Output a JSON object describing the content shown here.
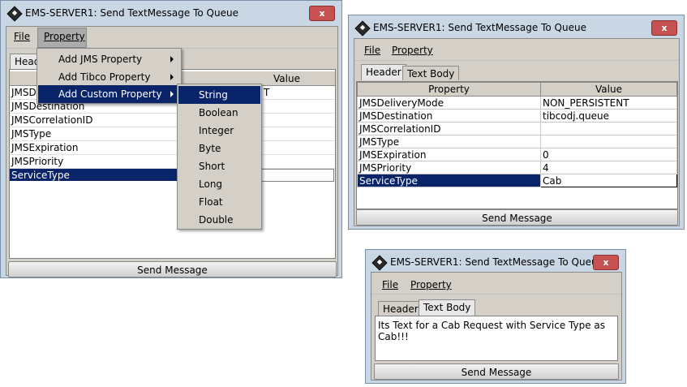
{
  "window_title": "EMS-SERVER1: Send TextMessage To Queue",
  "close_label": "x",
  "menu": {
    "file": "File",
    "property": "Property"
  },
  "tabs": {
    "header": "Header",
    "text_body": "Text Body"
  },
  "header_clipped": "Head",
  "columns": {
    "property": "Property",
    "value": "Value"
  },
  "rows": [
    {
      "property": "JMSDeliveryMode",
      "value": "NON_PERSISTENT"
    },
    {
      "property": "JMSDestination",
      "value": "tibcodj.queue"
    },
    {
      "property": "JMSCorrelationID",
      "value": ""
    },
    {
      "property": "JMSType",
      "value": ""
    },
    {
      "property": "JMSExpiration",
      "value": "0"
    },
    {
      "property": "JMSPriority",
      "value": "4"
    },
    {
      "property": "ServiceType",
      "value": "Cab"
    }
  ],
  "left_rows_visible": {
    "r0": "JMSDel",
    "r1": "JMSDestination",
    "r2": "JMSCorrelationID",
    "r3": "JMSType",
    "r4": "JMSExpiration",
    "r5": "JMSPriority",
    "r6": "ServiceType",
    "v0": "T"
  },
  "property_menu": [
    "Add JMS Property",
    "Add Tibco Property",
    "Add Custom Property"
  ],
  "custom_types": [
    "String",
    "Boolean",
    "Integer",
    "Byte",
    "Short",
    "Long",
    "Float",
    "Double"
  ],
  "send_button": "Send Message",
  "text_body": "Its Text for a Cab Request with Service Type as Cab!!!",
  "colors": {
    "selection": "#0a246a",
    "titlebar": "#c9d6e4",
    "close": "#c75050"
  }
}
